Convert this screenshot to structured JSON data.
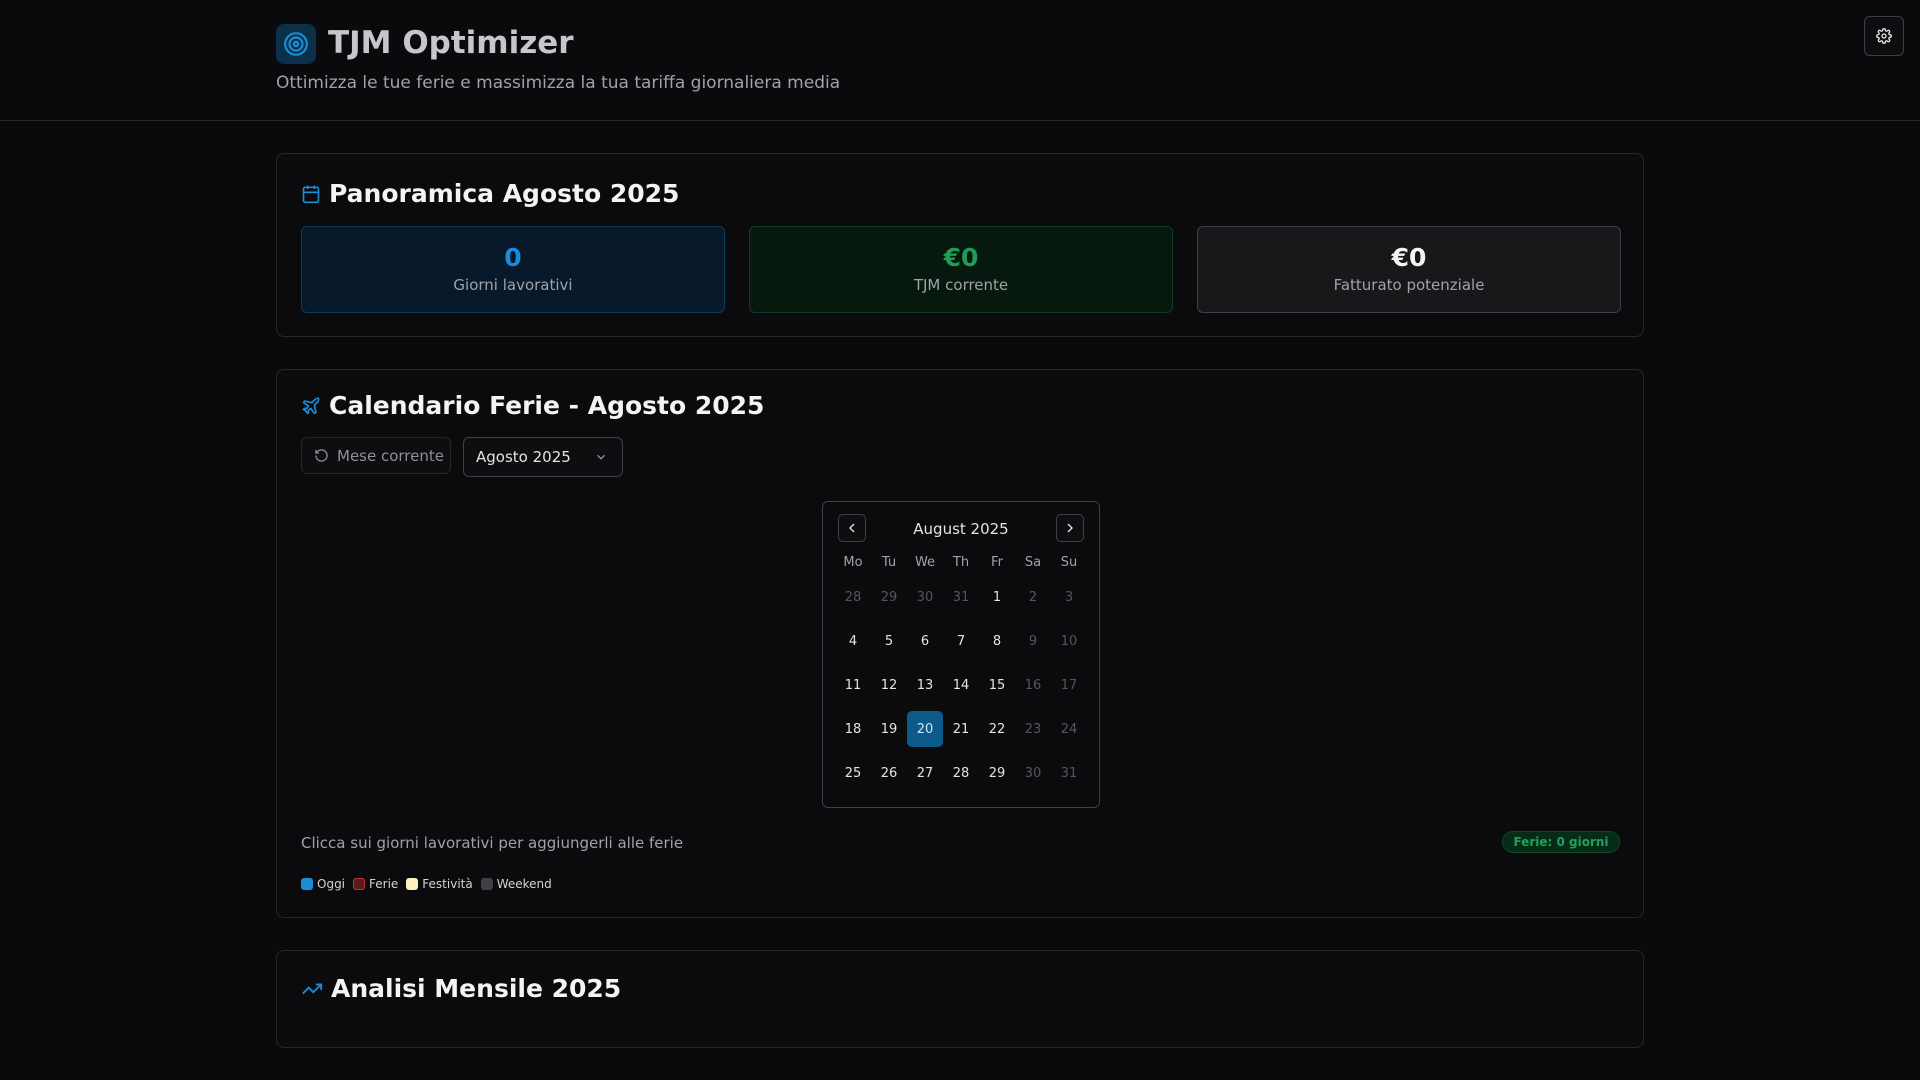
{
  "header": {
    "title": "TJM Optimizer",
    "subtitle": "Ottimizza le tue ferie e massimizza la tua tariffa giornaliera media",
    "logo_icon": "target-icon",
    "settings_icon": "gear-icon"
  },
  "overview": {
    "title": "Panoramica Agosto 2025",
    "icon": "calendar-icon",
    "stats": [
      {
        "value": "0",
        "label": "Giorni lavorativi",
        "color": "#1a8dd9"
      },
      {
        "value": "€0",
        "label": "TJM corrente",
        "color": "#1f9d55"
      },
      {
        "value": "€0",
        "label": "Fatturato potenziale",
        "color": "#f4f4f5"
      }
    ]
  },
  "vacation_calendar": {
    "title": "Calendario Ferie - Agosto 2025",
    "icon": "plane-icon",
    "reset_button": "Mese corrente",
    "reset_icon": "rotate-ccw-icon",
    "month_select": "Agosto 2025",
    "calendar": {
      "month_label": "August 2025",
      "weekdays": [
        "Mo",
        "Tu",
        "We",
        "Th",
        "Fr",
        "Sa",
        "Su"
      ],
      "weeks": [
        [
          "28",
          "29",
          "30",
          "31",
          "1",
          "2",
          "3"
        ],
        [
          "4",
          "5",
          "6",
          "7",
          "8",
          "9",
          "10"
        ],
        [
          "11",
          "12",
          "13",
          "14",
          "15",
          "16",
          "17"
        ],
        [
          "18",
          "19",
          "20",
          "21",
          "22",
          "23",
          "24"
        ],
        [
          "25",
          "26",
          "27",
          "28",
          "29",
          "30",
          "31"
        ]
      ],
      "today": "20"
    },
    "hint": "Clicca sui giorni lavorativi per aggiungerli alle ferie",
    "badge": "Ferie: 0 giorni",
    "legend": [
      {
        "label": "Oggi",
        "color": "#1a8dd9"
      },
      {
        "label": "Ferie",
        "color": "#5a1a1a"
      },
      {
        "label": "Festività",
        "color": "#fdf0c4"
      },
      {
        "label": "Weekend",
        "color": "#3f3f46"
      }
    ]
  },
  "monthly_analysis": {
    "title": "Analisi Mensile 2025",
    "icon": "trending-up-icon"
  }
}
